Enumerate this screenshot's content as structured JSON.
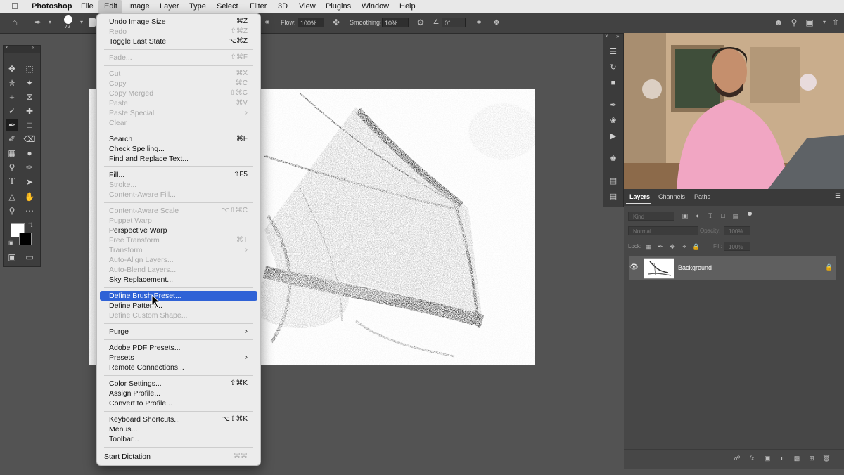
{
  "menubar": {
    "apple": "",
    "items": [
      "Photoshop",
      "File",
      "Edit",
      "Image",
      "Layer",
      "Type",
      "Select",
      "Filter",
      "3D",
      "View",
      "Plugins",
      "Window",
      "Help"
    ]
  },
  "options": {
    "brush_size": "72",
    "flow_label": "Flow:",
    "flow_value": "100%",
    "smoothing_label": "Smoothing:",
    "smoothing_value": "10%",
    "angle_value": "0°"
  },
  "edit_menu": {
    "undo": {
      "label": "Undo Image Size",
      "shortcut": "⌘Z"
    },
    "redo": {
      "label": "Redo",
      "shortcut": "⇧⌘Z"
    },
    "toggle": {
      "label": "Toggle Last State",
      "shortcut": "⌥⌘Z"
    },
    "fade": {
      "label": "Fade...",
      "shortcut": "⇧⌘F"
    },
    "cut": {
      "label": "Cut",
      "shortcut": "⌘X"
    },
    "copy": {
      "label": "Copy",
      "shortcut": "⌘C"
    },
    "copy_merged": {
      "label": "Copy Merged",
      "shortcut": "⇧⌘C"
    },
    "paste": {
      "label": "Paste",
      "shortcut": "⌘V"
    },
    "paste_special": {
      "label": "Paste Special",
      "shortcut": "›"
    },
    "clear": {
      "label": "Clear",
      "shortcut": ""
    },
    "search": {
      "label": "Search",
      "shortcut": "⌘F"
    },
    "check_spelling": {
      "label": "Check Spelling...",
      "shortcut": ""
    },
    "find_replace": {
      "label": "Find and Replace Text...",
      "shortcut": ""
    },
    "fill": {
      "label": "Fill...",
      "shortcut": "⇧F5"
    },
    "stroke": {
      "label": "Stroke...",
      "shortcut": ""
    },
    "content_aware_fill": {
      "label": "Content-Aware Fill...",
      "shortcut": ""
    },
    "content_aware_scale": {
      "label": "Content-Aware Scale",
      "shortcut": "⌥⇧⌘C"
    },
    "puppet_warp": {
      "label": "Puppet Warp",
      "shortcut": ""
    },
    "perspective_warp": {
      "label": "Perspective Warp",
      "shortcut": ""
    },
    "free_transform": {
      "label": "Free Transform",
      "shortcut": "⌘T"
    },
    "transform": {
      "label": "Transform",
      "shortcut": "›"
    },
    "auto_align": {
      "label": "Auto-Align Layers...",
      "shortcut": ""
    },
    "auto_blend": {
      "label": "Auto-Blend Layers...",
      "shortcut": ""
    },
    "sky_replacement": {
      "label": "Sky Replacement...",
      "shortcut": ""
    },
    "define_brush": {
      "label": "Define Brush Preset...",
      "shortcut": ""
    },
    "define_pattern": {
      "label": "Define Pattern...",
      "shortcut": ""
    },
    "define_shape": {
      "label": "Define Custom Shape...",
      "shortcut": ""
    },
    "purge": {
      "label": "Purge",
      "shortcut": "›"
    },
    "pdf_presets": {
      "label": "Adobe PDF Presets...",
      "shortcut": ""
    },
    "presets": {
      "label": "Presets",
      "shortcut": "›"
    },
    "remote": {
      "label": "Remote Connections...",
      "shortcut": ""
    },
    "color_settings": {
      "label": "Color Settings...",
      "shortcut": "⇧⌘K"
    },
    "assign_profile": {
      "label": "Assign Profile...",
      "shortcut": ""
    },
    "convert_profile": {
      "label": "Convert to Profile...",
      "shortcut": ""
    },
    "keyboard_shortcuts": {
      "label": "Keyboard Shortcuts...",
      "shortcut": "⌥⇧⌘K"
    },
    "menus": {
      "label": "Menus...",
      "shortcut": ""
    },
    "toolbar": {
      "label": "Toolbar...",
      "shortcut": ""
    },
    "dictation": {
      "label": "Start Dictation",
      "shortcut": "⌘⌘"
    }
  },
  "layers_panel": {
    "tabs": [
      "Layers",
      "Channels",
      "Paths"
    ],
    "kind_placeholder": "Kind",
    "blend_mode": "Normal",
    "opacity_label": "Opacity:",
    "opacity_value": "100%",
    "lock_label": "Lock:",
    "fill_label": "Fill:",
    "fill_value": "100%",
    "layer_name": "Background"
  }
}
